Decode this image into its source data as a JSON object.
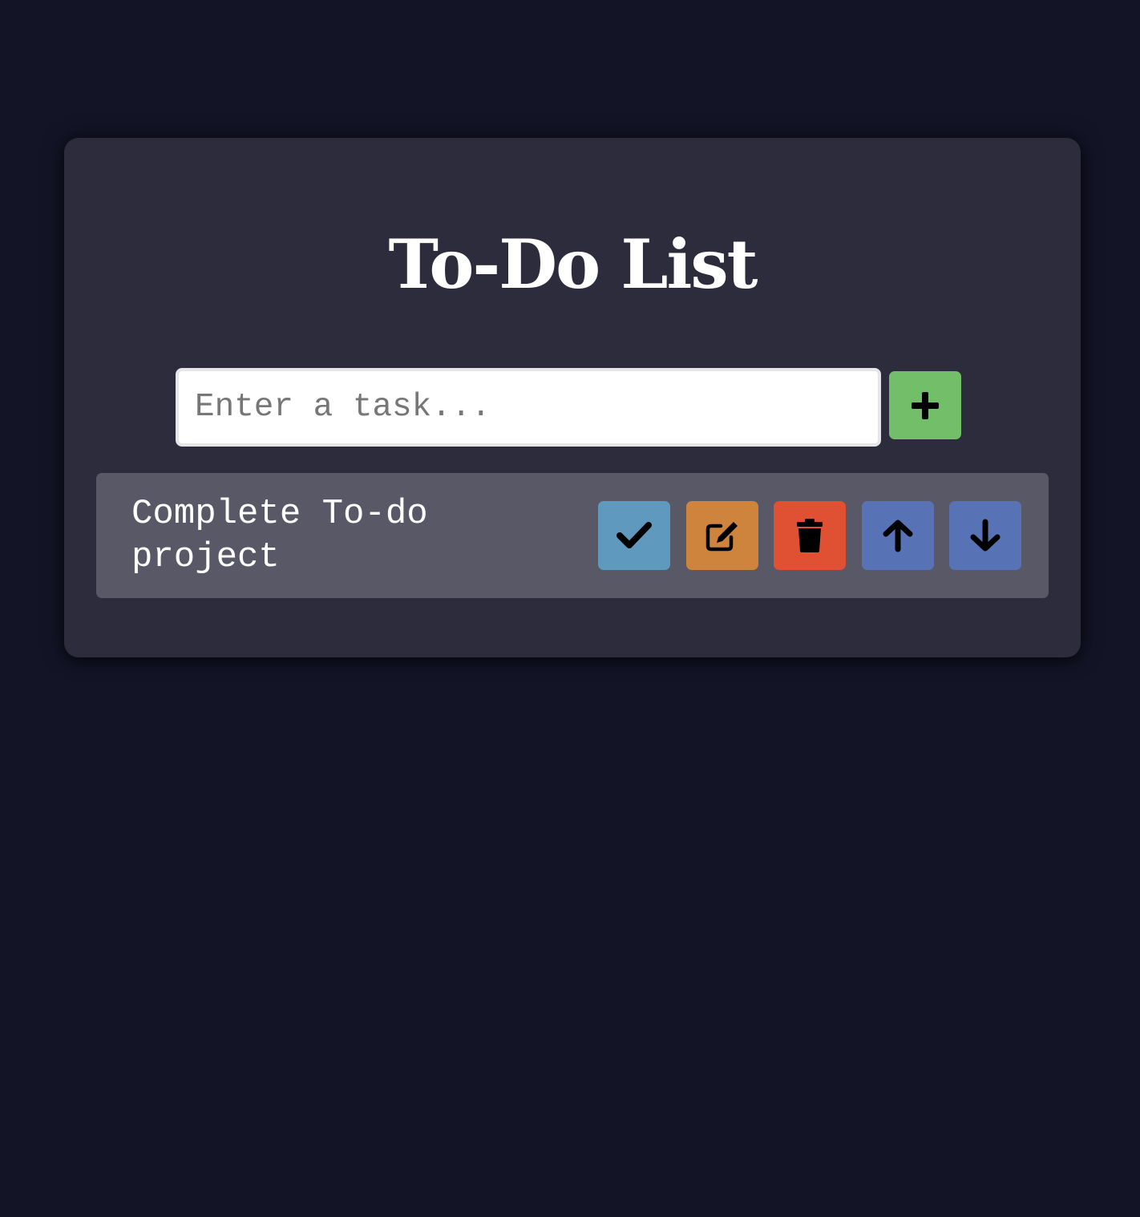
{
  "app": {
    "title": "To-Do List"
  },
  "input": {
    "placeholder": "Enter a task...",
    "value": ""
  },
  "add_button": {
    "icon": "plus-icon",
    "color": "#73bf69"
  },
  "tasks": [
    {
      "text": "Complete To-do project",
      "actions": [
        {
          "name": "complete",
          "icon": "check-icon",
          "color": "#6099be"
        },
        {
          "name": "edit",
          "icon": "edit-icon",
          "color": "#cf843d"
        },
        {
          "name": "delete",
          "icon": "trash-icon",
          "color": "#e05133"
        },
        {
          "name": "move-up",
          "icon": "arrow-up-icon",
          "color": "#5872b6"
        },
        {
          "name": "move-down",
          "icon": "arrow-down-icon",
          "color": "#5872b6"
        }
      ]
    }
  ],
  "theme": {
    "page_background": "#131426",
    "card_background": "#2d2c3c",
    "task_background": "#595866",
    "text_color": "#ffffff"
  }
}
